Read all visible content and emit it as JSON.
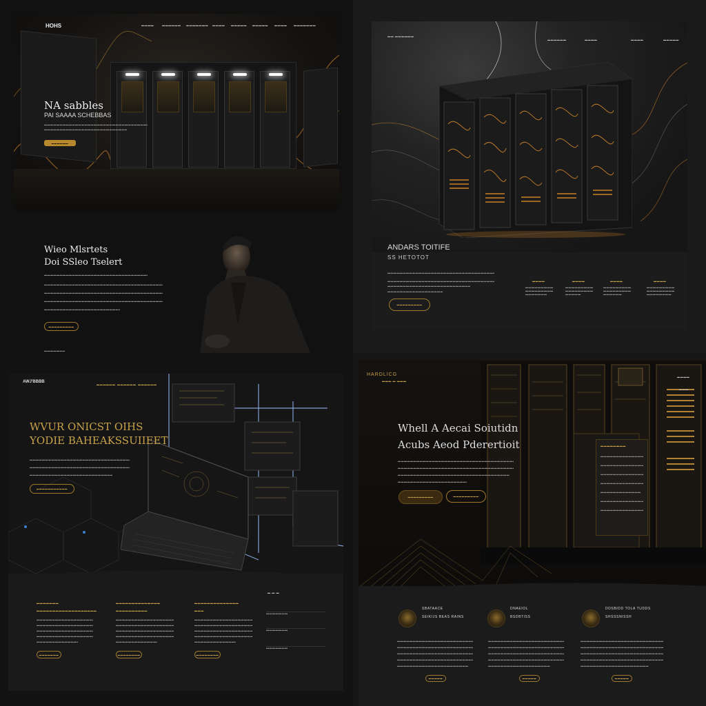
{
  "q1": {
    "brand": "HOHS",
    "nav": [
      "▬▬▬▬",
      "▬▬▬▬▬▬",
      "▬▬▬▬▬▬▬",
      "▬▬▬▬",
      "▬▬▬▬▬",
      "▬▬▬▬▬",
      "▬▬▬▬",
      "▬▬▬▬▬▬▬"
    ],
    "hero_title": "NA sabbles",
    "hero_subtitle": "PAI SAAAA SCHEBBAS",
    "hero_lines": [
      "▬▬▬▬▬▬▬▬▬▬▬▬▬▬▬▬▬▬▬▬▬▬▬▬▬▬▬▬▬▬▬▬▬▬▬▬▬▬▬▬▬",
      "▬▬▬▬▬▬▬▬▬▬▬▬▬▬▬▬▬▬▬▬▬▬▬▬▬▬▬▬▬▬▬"
    ],
    "hero_button": "▬▬▬▬▬▬",
    "section_title_1": "Wieo Mlsrtets",
    "section_title_2": "Doi SSleo Tselert",
    "body_lines": [
      "▬▬▬▬▬▬▬▬▬▬▬▬▬▬▬▬▬▬▬▬▬▬▬▬▬▬▬▬▬▬▬▬▬▬▬▬▬▬▬▬▬▬▬▬▬▬▬▬▬▬▬▬▬▬▬▬",
      "▬▬▬▬▬▬▬▬▬▬▬▬▬▬▬▬▬▬▬▬▬▬▬▬▬▬▬▬▬▬▬▬▬▬▬▬▬▬▬▬▬▬▬▬▬▬▬▬▬▬▬▬▬▬▬▬▬▬▬",
      "▬▬▬▬▬▬▬▬▬▬▬▬▬▬▬▬▬▬▬▬▬▬▬▬▬▬▬▬▬▬▬▬▬▬▬▬▬▬▬▬▬▬▬▬▬▬▬▬▬▬▬▬▬▬▬▬▬",
      "▬▬▬▬▬▬▬▬▬▬▬▬▬▬▬▬▬▬▬▬▬▬▬▬▬▬▬▬▬▬▬▬▬▬▬▬▬▬▬▬▬▬▬▬▬▬▬▬▬▬▬▬▬▬▬▬▬▬▬▬",
      "▬▬▬▬▬▬▬▬▬▬▬▬▬▬▬▬▬▬▬▬▬▬▬▬▬▬▬▬▬▬▬▬▬▬▬▬▬▬"
    ],
    "section_button": "▬▬▬▬▬▬▬▬▬",
    "footer_text": "▬▬▬▬▬▬▬"
  },
  "q2": {
    "brand": "▬▬ ▬▬▬▬▬▬",
    "nav": [
      "▬▬▬▬▬▬",
      "▬▬▬▬",
      "▬▬▬▬",
      "▬▬▬▬▬"
    ],
    "title_1": "ANDARS TOITIFE",
    "title_2": "SS HETOTOT",
    "body_lines": [
      "▬▬▬▬▬▬▬▬▬▬▬▬▬▬▬▬▬▬▬▬▬▬▬▬▬▬▬▬▬▬▬▬▬▬▬▬▬▬▬▬▬▬▬▬▬▬▬▬▬▬",
      "▬▬▬▬▬▬▬▬▬▬▬▬▬▬▬▬▬▬▬▬▬▬▬▬▬▬▬▬▬▬▬▬▬▬▬▬▬▬▬▬▬▬▬▬▬▬▬▬▬▬",
      "▬▬▬▬▬▬▬▬▬▬▬▬▬▬▬▬▬▬▬▬▬▬▬▬▬▬▬▬▬▬▬▬▬▬▬▬▬▬▬",
      "▬▬▬▬▬▬▬▬▬▬▬▬▬▬▬▬▬▬▬▬▬▬▬"
    ],
    "button": "▬▬▬▬▬▬▬▬▬",
    "stats": [
      {
        "head": "▬▬▬▬",
        "lines": [
          "▬▬▬▬▬▬▬▬▬",
          "▬▬▬▬▬▬▬▬▬",
          "▬▬▬▬▬▬▬"
        ]
      },
      {
        "head": "▬▬▬▬",
        "lines": [
          "▬▬▬▬▬▬▬▬▬",
          "▬▬▬▬▬▬▬▬▬",
          "▬▬▬▬▬"
        ]
      },
      {
        "head": "▬▬▬▬",
        "lines": [
          "▬▬▬▬▬▬▬▬▬",
          "▬▬▬▬▬▬▬▬▬",
          "▬▬▬▬▬▬"
        ]
      },
      {
        "head": "▬▬▬▬",
        "lines": [
          "▬▬▬▬▬▬▬▬▬",
          "▬▬▬▬▬▬▬▬▬",
          "▬▬▬▬▬▬▬▬"
        ]
      }
    ]
  },
  "q3": {
    "brand": "AWJ'BBBB",
    "nav": [
      "▬▬▬▬▬▬",
      "▬▬▬▬▬▬",
      "▬▬▬▬▬▬"
    ],
    "title_1": "WVUR ONICST OIHS",
    "title_2": "YODIE BAHEAKSSUIIEET",
    "body_lines": [
      "▬▬▬▬▬▬▬▬▬▬▬▬▬▬▬▬▬▬▬▬▬▬▬▬▬▬▬▬▬▬▬▬▬▬▬▬▬▬▬▬▬▬▬▬▬▬▬▬▬▬▬▬▬",
      "▬▬▬▬▬▬▬▬▬▬▬▬▬▬▬▬▬▬▬▬▬▬▬▬▬▬▬▬▬▬▬▬▬▬▬▬▬▬▬▬▬▬▬▬▬▬▬▬▬▬▬▬",
      "▬▬▬▬▬▬▬▬▬▬▬▬▬▬▬▬▬▬▬▬▬▬▬▬▬▬▬▬▬▬▬▬▬▬▬▬▬▬▬▬▬▬▬▬▬"
    ],
    "hero_button": "▬▬▬▬▬▬▬▬▬▬▬",
    "columns": [
      {
        "title_1": "▬▬▬▬▬▬▬",
        "title_2": "▬▬▬▬▬▬▬▬▬▬▬▬▬▬▬▬▬▬▬",
        "lines": [
          "▬▬▬▬▬▬▬▬▬▬▬▬▬▬▬▬▬▬▬▬▬▬▬▬▬",
          "▬▬▬▬▬▬▬▬▬▬▬▬▬▬▬▬▬▬▬▬▬▬▬▬▬",
          "▬▬▬▬▬▬▬▬▬▬▬▬▬▬▬▬▬▬▬▬▬▬▬▬▬",
          "▬▬▬▬▬▬▬▬▬▬▬▬▬▬▬▬▬▬▬▬▬▬▬▬▬",
          "▬▬▬▬▬▬▬▬▬▬▬▬▬▬▬▬▬▬"
        ],
        "button": "▬▬▬▬▬▬▬"
      },
      {
        "title_1": "▬▬▬▬▬▬▬▬▬▬▬▬▬▬",
        "title_2": "▬▬▬▬▬▬▬▬▬▬",
        "lines": [
          "▬▬▬▬▬▬▬▬▬▬▬▬▬▬▬▬▬▬▬▬▬▬▬▬▬",
          "▬▬▬▬▬▬▬▬▬▬▬▬▬▬▬▬▬▬▬▬▬▬▬▬▬",
          "▬▬▬▬▬▬▬▬▬▬▬▬▬▬▬▬▬▬▬▬▬▬▬▬▬",
          "▬▬▬▬▬▬▬▬▬▬▬▬▬▬▬▬▬▬▬▬▬▬▬▬▬",
          "▬▬▬▬▬▬▬▬▬▬▬▬▬▬▬▬▬"
        ],
        "button": "▬▬▬▬▬▬▬▬"
      },
      {
        "title_1": "▬▬▬▬▬▬▬▬▬▬▬▬▬▬",
        "title_2": "▬▬▬",
        "lines": [
          "▬▬▬▬▬▬▬▬▬▬▬▬▬▬▬▬▬▬▬▬▬▬▬▬▬",
          "▬▬▬▬▬▬▬▬▬▬▬▬▬▬▬▬▬▬▬▬▬▬▬▬▬",
          "▬▬▬▬▬▬▬▬▬▬▬▬▬▬▬▬▬▬▬▬▬▬▬▬▬",
          "▬▬▬▬▬▬▬▬▬▬▬▬▬▬▬▬▬▬▬▬▬▬▬▬▬",
          "▬▬▬▬▬▬▬▬▬▬▬▬▬▬▬▬▬▬▬"
        ],
        "button": "▬▬▬▬▬▬▬▬"
      }
    ],
    "side_header": "▬ ▬ ▬",
    "side_fields": [
      "▬▬▬▬▬▬▬",
      "▬▬▬▬▬▬▬",
      "▬▬▬▬▬▬▬"
    ]
  },
  "q4": {
    "brand": "HARDLICG",
    "brand_sub": "▬▬▬ ▬ ▬▬▬",
    "nav": [
      "▬▬▬▬",
      "▬▬▬"
    ],
    "title_1": "Whell A Aecai Soiutidn",
    "title_2": "Acubs Aeod Pderertioit",
    "body_lines": [
      "▬▬▬▬▬▬▬▬▬▬▬▬▬▬▬▬▬▬▬▬▬▬▬▬▬▬▬▬▬▬▬▬▬▬▬▬▬▬▬▬▬▬▬▬▬▬▬▬▬▬▬▬▬▬▬",
      "▬▬▬▬▬▬▬▬▬▬▬▬▬▬▬▬▬▬▬▬▬▬▬▬▬▬▬▬▬▬▬▬▬▬▬▬▬▬▬▬▬▬▬▬▬▬▬▬▬▬▬▬▬▬▬",
      "▬▬▬▬▬▬▬▬▬▬▬▬▬▬▬▬▬▬▬▬▬▬▬▬▬▬▬▬▬▬▬▬▬▬▬▬▬▬▬▬▬▬▬▬▬▬▬▬▬▬▬▬▬▬",
      "▬▬▬▬▬▬▬▬▬▬▬▬▬▬▬▬▬▬▬▬▬▬▬▬▬▬▬▬▬▬▬▬"
    ],
    "button_primary": "▬▬▬▬▬▬▬▬▬",
    "button_secondary": "▬▬▬▬▬▬▬▬▬",
    "panel_title": "▬▬▬▬▬▬▬▬",
    "panel_lines": [
      "▬▬▬▬▬▬▬▬▬▬▬▬▬▬▬",
      "▬▬▬▬▬▬▬▬▬▬▬▬▬▬▬▬",
      "▬▬▬▬▬▬▬▬▬▬▬▬▬▬",
      "▬▬▬▬▬▬▬▬▬▬▬▬▬▬▬▬",
      "▬▬▬▬▬▬▬▬▬▬▬▬▬",
      "▬▬▬▬▬▬▬▬▬▬▬▬▬▬▬▬",
      "▬▬▬▬▬▬▬▬▬▬▬▬▬▬"
    ],
    "features": [
      {
        "title_1": "SBATAACE",
        "title_2": "SEIKIJS BEAS RAINS",
        "lines": [
          "▬▬▬▬▬▬▬▬▬▬▬▬▬▬▬▬▬▬▬▬▬▬▬▬▬▬▬▬▬▬",
          "▬▬▬▬▬▬▬▬▬▬▬▬▬▬▬▬▬▬▬▬▬▬▬▬▬▬▬▬▬▬",
          "▬▬▬▬▬▬▬▬▬▬▬▬▬▬▬▬▬▬▬▬▬▬▬▬▬▬▬▬▬▬",
          "▬▬▬▬▬▬▬▬▬▬▬▬▬▬▬▬▬▬▬▬▬▬▬▬▬▬▬▬▬▬",
          "▬▬▬▬▬▬▬▬▬▬▬▬▬▬▬▬▬▬▬▬▬▬▬"
        ],
        "button": "▬▬▬▬▬"
      },
      {
        "title_1": "DNAEIOL",
        "title_2": "BSDBTISS",
        "lines": [
          "▬▬▬▬▬▬▬▬▬▬▬▬▬▬▬▬▬▬▬▬▬▬▬▬▬▬▬▬",
          "▬▬▬▬▬▬▬▬▬▬▬▬▬▬▬▬▬▬▬▬▬▬▬▬▬▬▬▬",
          "▬▬▬▬▬▬▬▬▬▬▬▬▬▬▬▬▬▬▬▬▬▬▬▬▬▬▬▬",
          "▬▬▬▬▬▬▬▬▬▬▬▬▬▬▬▬▬▬▬▬▬▬▬▬▬▬▬▬",
          "▬▬▬▬▬▬▬▬▬▬▬▬▬▬▬▬▬▬▬▬"
        ],
        "button": "▬▬▬▬▬"
      },
      {
        "title_1": "DDSBIDD TOLA TUDDS",
        "title_2": "SHSSSNISSH",
        "lines": [
          "▬▬▬▬▬▬▬▬▬▬▬▬▬▬▬▬▬▬▬▬▬▬▬▬▬▬▬▬▬▬",
          "▬▬▬▬▬▬▬▬▬▬▬▬▬▬▬▬▬▬▬▬▬▬▬▬▬▬▬▬▬▬",
          "▬▬▬▬▬▬▬▬▬▬▬▬▬▬▬▬▬▬▬▬▬▬▬▬▬▬▬▬▬▬",
          "▬▬▬▬▬▬▬▬▬▬▬▬▬▬▬▬▬▬▬▬▬▬▬▬▬▬▬▬▬▬",
          "▬▬▬▬▬▬▬▬▬▬▬▬▬▬▬▬▬▬▬▬▬▬"
        ],
        "button": "▬▬▬▬▬"
      }
    ]
  },
  "colors": {
    "background": "#0c0c0c",
    "accent_gold": "#c9a24a",
    "button_gold": "#b8892c",
    "glow_orange": "#d9892a",
    "glow_blue": "#9fc4ff"
  }
}
